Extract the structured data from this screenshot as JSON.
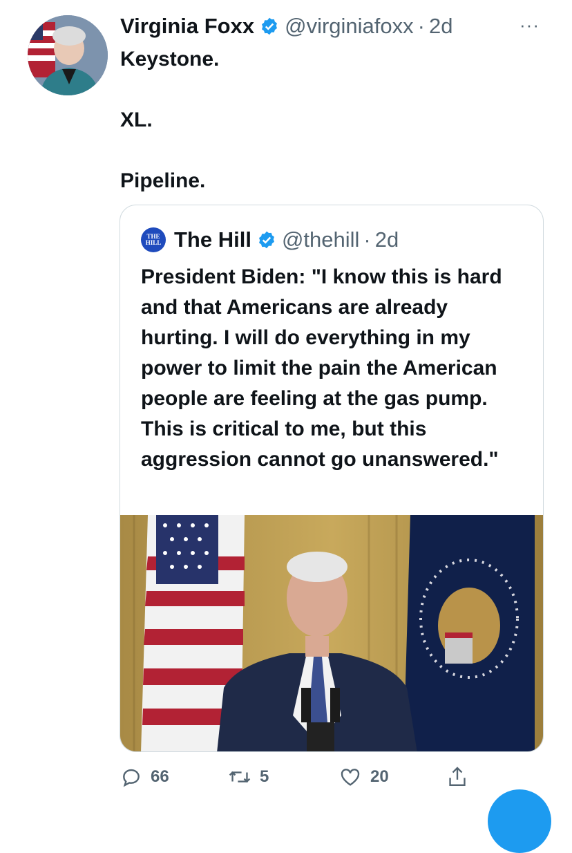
{
  "author": {
    "name": "Virginia Foxx",
    "handle": "@virginiafoxx",
    "separator": "·",
    "time": "2d",
    "more": "···"
  },
  "tweet": {
    "lines": [
      "Keystone.",
      "XL.",
      "Pipeline."
    ]
  },
  "quote": {
    "logo_line1": "THE",
    "logo_line2": "HILL",
    "name": "The Hill",
    "handle": "@thehill",
    "separator": "·",
    "time": "2d",
    "text": "President Biden: \"I know this is hard and that Americans are already hurting. I will do everything in my power to limit the pain the American people are feeling at the gas pump. This is critical to me, but this aggression cannot go unanswered.\""
  },
  "actions": {
    "replies": "66",
    "retweets": "5",
    "likes": "20"
  },
  "colors": {
    "verified": "#1d9bf0",
    "secondary_text": "#536471",
    "border": "#cfd9de",
    "hill_logo": "#1f4bbd"
  }
}
